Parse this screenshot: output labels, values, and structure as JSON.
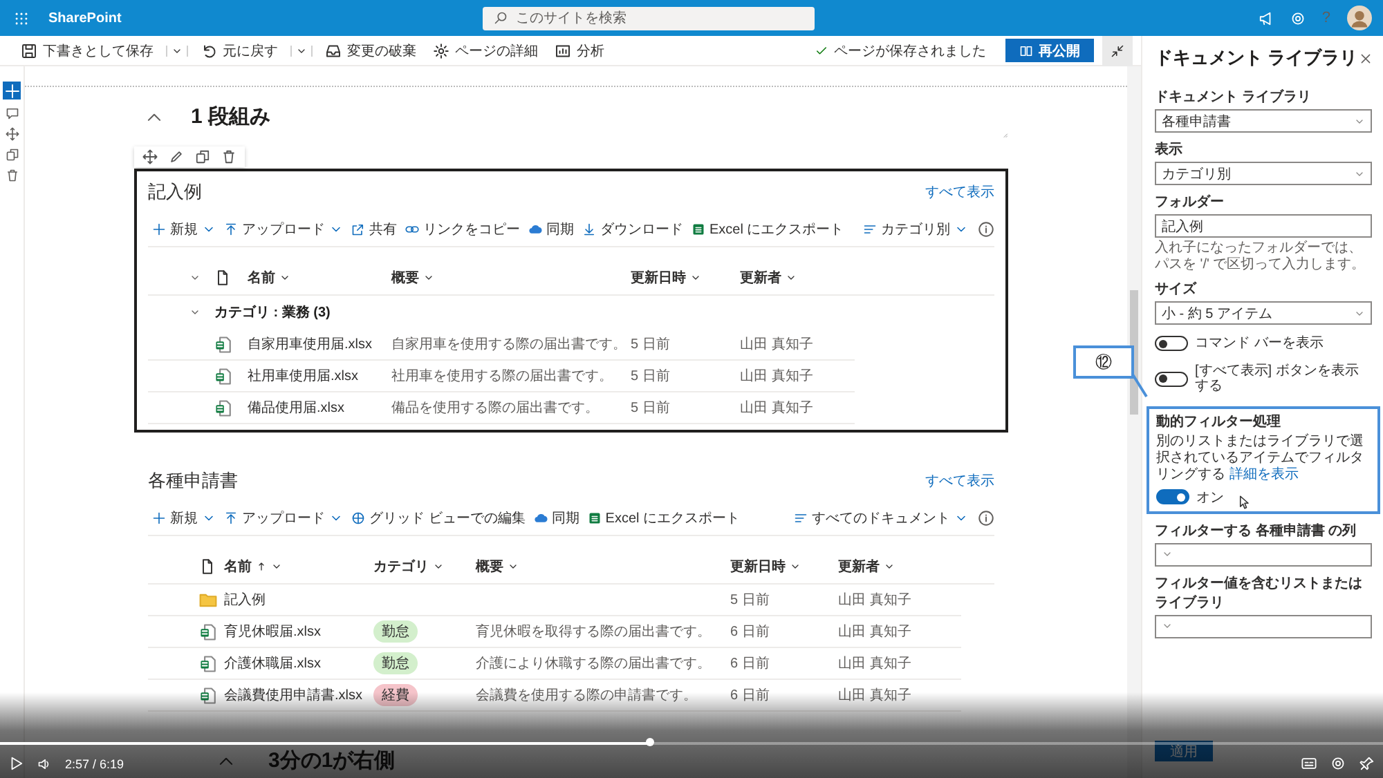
{
  "suite_bar": {
    "app_name": "SharePoint",
    "search_placeholder": "このサイトを検索",
    "help_label": "?"
  },
  "command_bar": {
    "items": [
      {
        "label": "下書きとして保存",
        "dropdown": true
      },
      {
        "label": "元に戻す",
        "dropdown": true
      },
      {
        "label": "変更の破棄",
        "dropdown": false
      },
      {
        "label": "ページの詳細",
        "dropdown": false
      },
      {
        "label": "分析",
        "dropdown": false
      }
    ],
    "status": "ページが保存されました",
    "publish_button": "再公開"
  },
  "section": {
    "title": "1 段組み"
  },
  "webparts": [
    {
      "title": "記入例",
      "selected": true,
      "see_all": "すべて表示",
      "commands": [
        {
          "label": "新規",
          "dropdown": true
        },
        {
          "label": "アップロード",
          "dropdown": true
        },
        {
          "label": "共有",
          "dropdown": false
        },
        {
          "label": "リンクをコピー",
          "dropdown": false
        },
        {
          "label": "同期",
          "dropdown": false
        },
        {
          "label": "ダウンロード",
          "dropdown": false
        },
        {
          "label": "Excel にエクスポート",
          "dropdown": false
        }
      ],
      "view": "カテゴリ別",
      "columns": [
        {
          "label": "名前",
          "sorted": false
        },
        {
          "label": "概要",
          "sorted": false
        },
        {
          "label": "更新日時",
          "sorted": false
        },
        {
          "label": "更新者",
          "sorted": false
        }
      ],
      "groups": [
        {
          "label": "カテゴリ : 業務 (3)",
          "expanded": true,
          "rows": [
            {
              "kind": "excel",
              "cells": [
                "自家用車使用届.xlsx",
                "自家用車を使用する際の届出書です。",
                "5 日前",
                "山田 真知子"
              ]
            },
            {
              "kind": "excel",
              "cells": [
                "社用車使用届.xlsx",
                "社用車を使用する際の届出書です。",
                "5 日前",
                "山田 真知子"
              ]
            },
            {
              "kind": "excel",
              "cells": [
                "備品使用届.xlsx",
                "備品を使用する際の届出書です。",
                "5 日前",
                "山田 真知子"
              ]
            }
          ]
        }
      ]
    },
    {
      "title": "各種申請書",
      "selected": false,
      "see_all": "すべて表示",
      "commands": [
        {
          "label": "新規",
          "dropdown": true
        },
        {
          "label": "アップロード",
          "dropdown": true
        },
        {
          "label": "グリッド ビューでの編集",
          "dropdown": false
        },
        {
          "label": "同期",
          "dropdown": false
        },
        {
          "label": "Excel にエクスポート",
          "dropdown": false
        }
      ],
      "view": "すべてのドキュメント",
      "columns": [
        {
          "label": "名前",
          "sorted": true
        },
        {
          "label": "カテゴリ",
          "sorted": false
        },
        {
          "label": "概要",
          "sorted": false
        },
        {
          "label": "更新日時",
          "sorted": false
        },
        {
          "label": "更新者",
          "sorted": false
        }
      ],
      "rows": [
        {
          "kind": "folder",
          "cells": [
            "記入例",
            null,
            null,
            "5 日前",
            "山田 真知子"
          ]
        },
        {
          "kind": "excel",
          "cells": [
            "育児休暇届.xlsx",
            {
              "tag": "勤怠",
              "color": "#d3efcc"
            },
            "育児休暇を取得する際の届出書です。",
            "6 日前",
            "山田 真知子"
          ]
        },
        {
          "kind": "excel",
          "cells": [
            "介護休職届.xlsx",
            {
              "tag": "勤怠",
              "color": "#d3efcc"
            },
            "介護により休職する際の届出書です。",
            "6 日前",
            "山田 真知子"
          ]
        },
        {
          "kind": "excel",
          "cells": [
            "会議費使用申請書.xlsx",
            {
              "tag": "経費",
              "color": "#f5c4ca"
            },
            "会議費を使用する際の申請書です。",
            "6 日前",
            "山田 真知子"
          ]
        }
      ]
    }
  ],
  "next_section": {
    "title": "3分の1が右側"
  },
  "panel": {
    "title": "ドキュメント ライブラリ",
    "fields": [
      {
        "kind": "dropdown",
        "label": "ドキュメント ライブラリ",
        "value": "各種申請書"
      },
      {
        "kind": "dropdown",
        "label": "表示",
        "value": "カテゴリ別"
      },
      {
        "kind": "text",
        "label": "フォルダー",
        "value": "記入例",
        "hint": "入れ子になったフォルダーでは、パスを '/' で区切って入力します。"
      },
      {
        "kind": "dropdown",
        "label": "サイズ",
        "value": "小 - 約 5 アイテム"
      },
      {
        "kind": "toggle",
        "label": "コマンド バーを表示",
        "on": false
      },
      {
        "kind": "toggle",
        "label": "[すべて表示] ボタンを表示する",
        "on": false
      },
      {
        "kind": "dynamic",
        "label": "動的フィルター処理",
        "description": "別のリストまたはライブラリで選択されているアイテムでフィルタリングする",
        "link": "詳細を表示",
        "on": true,
        "state_text": "オン",
        "highlighted": true
      },
      {
        "kind": "dropdown",
        "label": "フィルターする **各種申請書** の列"
      },
      {
        "kind": "dropdown",
        "label": "フィルター値を含むリストまたはライブラリ"
      }
    ],
    "apply_button": "適用"
  },
  "annotation": {
    "label": "⑫"
  },
  "video": {
    "time": "2:57 / 6:19",
    "level": 0.47
  }
}
